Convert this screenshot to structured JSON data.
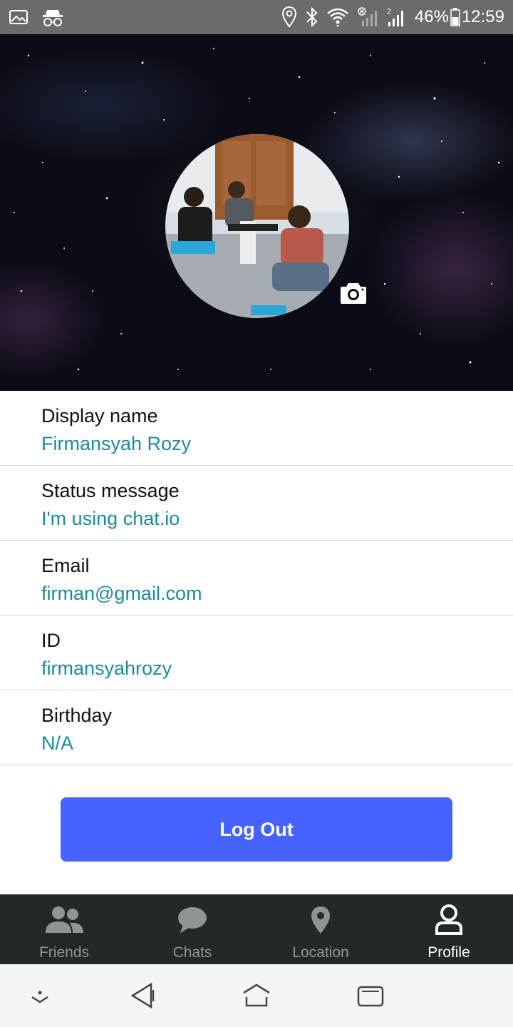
{
  "status_bar": {
    "icons_left": [
      "image-icon",
      "incognito-icon"
    ],
    "icons_right": [
      "location-icon",
      "bluetooth-icon",
      "wifi-icon",
      "signal-icon",
      "signal-2-icon"
    ],
    "battery": "46%",
    "time": "12:59"
  },
  "profile": {
    "avatar_icon": "avatar-photo",
    "camera_icon": "camera-icon",
    "fields": [
      {
        "label": "Display name",
        "value": "Firmansyah Rozy"
      },
      {
        "label": "Status message",
        "value": "I'm using chat.io"
      },
      {
        "label": "Email",
        "value": "firman@gmail.com"
      },
      {
        "label": "ID",
        "value": "firmansyahrozy"
      },
      {
        "label": "Birthday",
        "value": "N/A"
      }
    ]
  },
  "logout_label": "Log Out",
  "tabs": [
    {
      "label": "Friends",
      "icon": "friends-icon",
      "active": false
    },
    {
      "label": "Chats",
      "icon": "chat-bubble-icon",
      "active": false
    },
    {
      "label": "Location",
      "icon": "map-pin-icon",
      "active": false
    },
    {
      "label": "Profile",
      "icon": "person-icon",
      "active": true
    }
  ],
  "system_nav": [
    "hide-keyboard-icon",
    "back-icon",
    "home-icon",
    "recents-icon"
  ],
  "colors": {
    "accent": "#4563ff",
    "value_text": "#1b8aa0",
    "tabbar_bg": "#232828",
    "status_bar_bg": "#6b6b6b"
  }
}
